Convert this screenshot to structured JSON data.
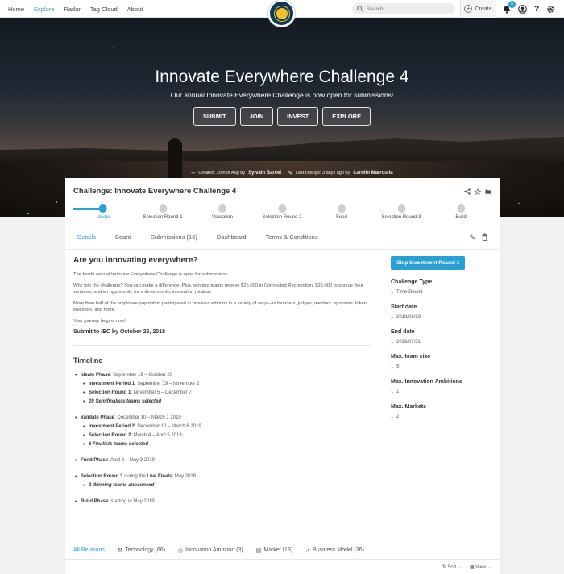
{
  "nav": {
    "links": [
      "Home",
      "Explore",
      "Radar",
      "Tag Cloud",
      "About"
    ],
    "active": "Explore",
    "search_placeholder": "Search",
    "create_label": "Create",
    "notification_count": "5"
  },
  "hero": {
    "title": "Innovate Everywhere Challenge 4",
    "subtitle": "Our annual Innovate Everywhere Challenge is now open for submissions!",
    "buttons": [
      "SUBMIT",
      "JOIN",
      "INVEST",
      "EXPLORE"
    ],
    "created_label": "Created: 29th of Aug by",
    "created_by": "Sylvain Barcel",
    "changed_label": "Last change: 3 days ago by",
    "changed_by": "Carolin Marroulla"
  },
  "challenge": {
    "title": "Challenge: Innovate Everywhere Challenge 4",
    "steps": [
      "Ideate",
      "Selection Round 1",
      "Validation",
      "Selection Round 2",
      "Fund",
      "Selection Round 3",
      "Build"
    ],
    "active_step": "Ideate"
  },
  "tabs": [
    "Details",
    "Board",
    "Submissions (16)",
    "Dashboard",
    "Terms & Conditions"
  ],
  "details": {
    "heading": "Are you innovating everywhere?",
    "paragraphs": [
      "The fourth annual Innovate Everywhere Challenge is open for submissions.",
      "Why join the challenge? You can make a difference! Plus, winning teams receive $25,000 in Connected Recognition, $25,000 to pursue their ventures, and an opportunity for a three-month, innovation rotation.",
      "More than half of the employee population participated in previous editions in a variety of ways–as founders, judges, mentors, sponsors, token investors, and more.",
      "Your journey begins now!"
    ],
    "deadline": "Submit to IEC by October 26, 2018"
  },
  "timeline": {
    "heading": "Timeline",
    "ideate_phase": "Ideate Phase",
    "ideate_dates": ": September 19 – October 26",
    "inv1": "Investment Period 1",
    "inv1_dates": ": September 19 – November 2",
    "sel1": "Selection Round 1",
    "sel1_dates": ": November 5 – December 7",
    "sel1_result": "20 Semifinalists teams selected",
    "validate_phase": "Validate Phase",
    "validate_dates": ": December 10 – March 1 2019",
    "inv2": "Investment Period 2",
    "inv2_dates": ": December 10 – March 8 2019",
    "sel2": "Selection Round 2",
    "sel2_dates": ": March 4 – April 5 2019",
    "sel2_result": "6 Finalists teams selected",
    "fund_phase": "Fund Phase",
    "fund_dates": ": April 8 – May 3 2019",
    "sel3": "Selection Round 3",
    "sel3_mid": " during the ",
    "live_finals": "Live Finals",
    "sel3_dates": ": May 2019",
    "sel3_result": "3 Winning teams announced",
    "build_phase": "Build Phase",
    "build_dates": ": starting in May 2019"
  },
  "sidebar": {
    "action_button": "Stop Investment Round 1",
    "fields": [
      {
        "label": "Challenge Type",
        "value": "Time-Bound"
      },
      {
        "label": "Start date",
        "value": "2018/08/29"
      },
      {
        "label": "End date",
        "value": "2019/07/31"
      },
      {
        "label": "Max. team size",
        "value": "5"
      },
      {
        "label": "Max. Innovation Ambitions",
        "value": "1"
      },
      {
        "label": "Max. Markets",
        "value": "2"
      }
    ]
  },
  "relations": {
    "tabs": [
      "All Relations",
      "Technology (66)",
      "Innovation Ambition (3)",
      "Market (13)",
      "Business Model (26)"
    ],
    "sort_label": "Sort",
    "view_label": "View"
  },
  "colors": {
    "accent": "#2a9fd6",
    "logo_bg": "#0e3a5c",
    "logo_sun": "#f2c12e"
  }
}
